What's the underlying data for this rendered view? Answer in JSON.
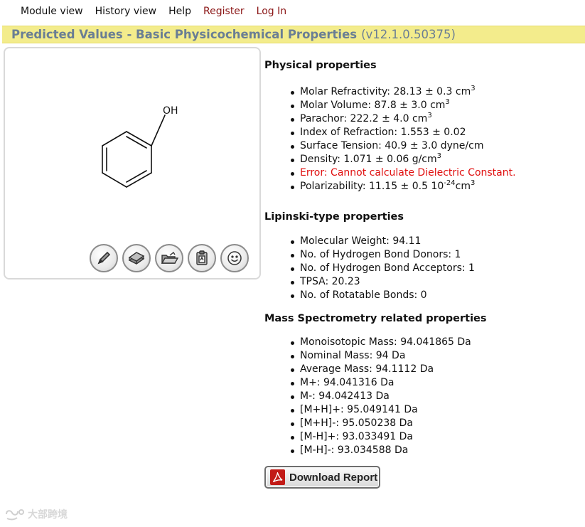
{
  "nav": {
    "items": [
      {
        "label": "Module view",
        "style": "plain"
      },
      {
        "label": "History view",
        "style": "plain"
      },
      {
        "label": "Help",
        "style": "plain"
      },
      {
        "label": "Register",
        "style": "accent"
      },
      {
        "label": "Log In",
        "style": "accent"
      }
    ]
  },
  "title": {
    "text": "Predicted Values - Basic Physicochemical Properties",
    "version": "(v12.1.0.50375)"
  },
  "structure": {
    "oh_label": "OH",
    "tools": [
      "pencil-icon",
      "book-icon",
      "open-folder-icon",
      "clipboard-icon",
      "smiley-icon"
    ]
  },
  "sections": {
    "physical": {
      "title": "Physical properties",
      "items": [
        {
          "text": "Molar Refractivity: 28.13 ± 0.3 cm",
          "sup": "3",
          "after": ""
        },
        {
          "text": "Molar Volume: 87.8 ± 3.0 cm",
          "sup": "3",
          "after": ""
        },
        {
          "text": "Parachor: 222.2 ± 4.0 cm",
          "sup": "3",
          "after": ""
        },
        {
          "text": "Index of Refraction: 1.553 ± 0.02",
          "sup": "",
          "after": ""
        },
        {
          "text": "Surface Tension: 40.9 ± 3.0 dyne/cm",
          "sup": "",
          "after": ""
        },
        {
          "text": "Density: 1.071 ± 0.06 g/cm",
          "sup": "3",
          "after": ""
        },
        {
          "text": "Error: Cannot calculate Dielectric Constant.",
          "sup": "",
          "after": "",
          "error": true
        },
        {
          "text": "Polarizability: 11.15 ± 0.5 10",
          "sup": "-24",
          "after": "cm",
          "sup2": "3"
        }
      ]
    },
    "lipinski": {
      "title": "Lipinski-type properties",
      "items": [
        "Molecular Weight: 94.11",
        "No. of Hydrogen Bond Donors: 1",
        "No. of Hydrogen Bond Acceptors: 1",
        "TPSA: 20.23",
        "No. of Rotatable Bonds: 0"
      ]
    },
    "mass": {
      "title": "Mass Spectrometry related properties",
      "items": [
        "Monoisotopic Mass: 94.041865 Da",
        "Nominal Mass: 94 Da",
        "Average Mass: 94.1112 Da",
        "M+: 94.041316 Da",
        "M-: 94.042413 Da",
        "[M+H]+: 95.049141 Da",
        "[M+H]-: 95.050238 Da",
        "[M-H]+: 93.033491 Da",
        "[M-H]-: 93.034588 Da"
      ]
    }
  },
  "download": {
    "label": "Download Report"
  },
  "watermark": {
    "text": "大部跨境"
  },
  "colors": {
    "title_bar_bg": "#f3ec8c",
    "title_text": "#6a7e94",
    "nav_accent": "#8a1414",
    "error": "#e01010",
    "pdf_red": "#c21b17"
  }
}
